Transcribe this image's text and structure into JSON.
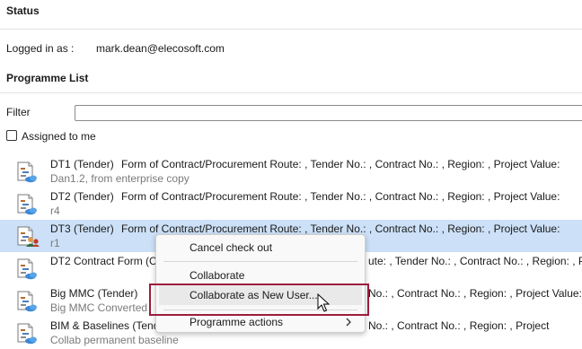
{
  "status": {
    "title": "Status",
    "logged_in_label": "Logged in as :",
    "logged_in_value": "mark.dean@elecosoft.com"
  },
  "programme_list": {
    "title": "Programme List",
    "filter_label": "Filter",
    "filter_value": "",
    "assigned_label": "Assigned to me",
    "assigned_checked": false
  },
  "programmes": [
    {
      "name": "DT1 (Tender)",
      "desc": "Form of Contract/Procurement Route: , Tender No.: , Contract No.: , Region: , Project Value:",
      "sub": "Dan1.2, from enterprise copy"
    },
    {
      "name": "DT2 (Tender)",
      "desc": "Form of Contract/Procurement Route: , Tender No.: , Contract No.: , Region: , Project Value:",
      "sub": "r4"
    },
    {
      "name": "DT3 (Tender)",
      "desc": "Form of Contract/Procurement Route: , Tender No.: , Contract No.: , Region: , Project Value:",
      "sub": "r1"
    },
    {
      "name": "DT2  Contract Form (C",
      "desc": "ute: , Tender No.: , Contract No.: , Region: , Pr",
      "sub": ""
    },
    {
      "name": "Big MMC (Tender)",
      "desc": "No.: , Contract No.: , Region: , Project Value:",
      "sub": "Big MMC Converted"
    },
    {
      "name": "BIM & Baselines (Tend",
      "desc": "No.: , Contract No.: , Region: , Project",
      "sub": "Collab permanent baseline"
    }
  ],
  "context_menu": {
    "items": [
      {
        "label": "Cancel check out"
      },
      {
        "label": "Collaborate"
      },
      {
        "label": "Collaborate as New User..."
      },
      {
        "label": "Programme actions"
      }
    ]
  },
  "colors": {
    "selected_row": "#cce0f7",
    "highlight_border": "#9c1c3c"
  }
}
